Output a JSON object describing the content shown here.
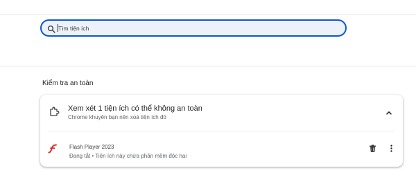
{
  "search": {
    "placeholder": "Tìm tiện ích",
    "value": ""
  },
  "safety": {
    "section_title": "Kiểm tra an toàn",
    "card": {
      "title": "Xem xét 1 tiện ích có thể không an toàn",
      "subtitle": "Chrome khuyên bạn nên xoá tiện ích đó",
      "extension": {
        "name": "Flash Player 2023",
        "status": "Đang tắt • Tiện ích này chứa phần mềm độc hại"
      }
    }
  },
  "icons": [
    "search-icon",
    "puzzle-icon",
    "chevron-up-icon",
    "flash-icon",
    "trash-icon",
    "more-vert-icon"
  ],
  "colors": {
    "accent": "#0b57d0",
    "search_bg": "#edf2fa",
    "flash_red": "#d93025"
  }
}
